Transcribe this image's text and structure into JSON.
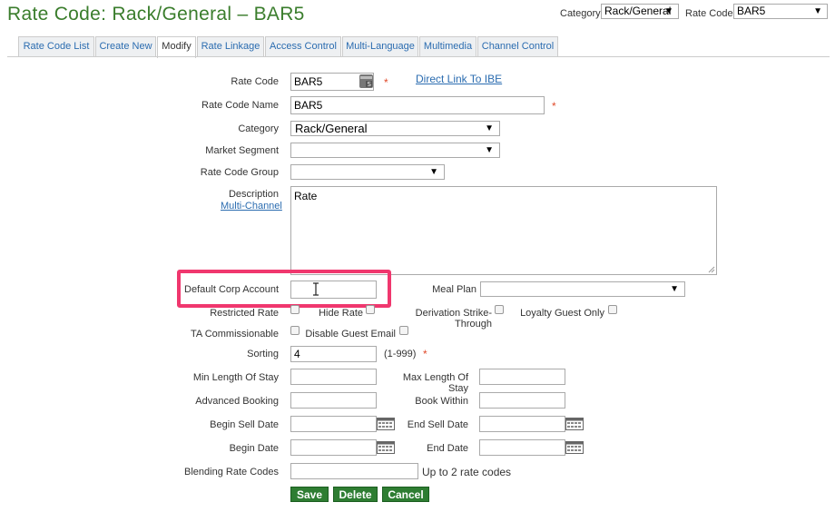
{
  "title": "Rate Code: Rack/General – BAR5",
  "top": {
    "category_label": "Category",
    "category_value": "Rack/General",
    "rate_code_label": "Rate Code",
    "rate_code_value": "BAR5"
  },
  "tabs": [
    {
      "label": "Rate Code List"
    },
    {
      "label": "Create New"
    },
    {
      "label": "Modify",
      "active": true
    },
    {
      "label": "Rate Linkage"
    },
    {
      "label": "Access Control"
    },
    {
      "label": "Multi-Language"
    },
    {
      "label": "Multimedia"
    },
    {
      "label": "Channel Control"
    }
  ],
  "form": {
    "rate_code_label": "Rate Code",
    "rate_code_value": "BAR5",
    "direct_link": "Direct Link To IBE",
    "rate_code_name_label": "Rate Code Name",
    "rate_code_name_value": "BAR5",
    "category_label": "Category",
    "category_value": "Rack/General",
    "market_segment_label": "Market Segment",
    "market_segment_value": "",
    "rate_code_group_label": "Rate Code Group",
    "rate_code_group_value": "",
    "description_label": "Description",
    "multi_channel_link": "Multi-Channel",
    "description_value": "Rate",
    "default_corp_label": "Default Corp Account",
    "default_corp_value": "",
    "meal_plan_label": "Meal Plan",
    "meal_plan_value": "",
    "restricted_rate_label": "Restricted Rate",
    "hide_rate_label": "Hide Rate",
    "derivation_label": "Derivation Strike-Through",
    "loyalty_label": "Loyalty Guest Only",
    "ta_label": "TA Commissionable",
    "disable_email_label": "Disable Guest Email",
    "sorting_label": "Sorting",
    "sorting_value": "4",
    "sorting_hint": "(1-999)",
    "min_los_label": "Min Length Of Stay",
    "max_los_label": "Max Length Of Stay",
    "adv_booking_label": "Advanced Booking",
    "book_within_label": "Book Within",
    "begin_sell_label": "Begin Sell Date",
    "end_sell_label": "End Sell Date",
    "begin_date_label": "Begin Date",
    "end_date_label": "End Date",
    "blending_label": "Blending Rate Codes",
    "blending_hint": "Up to 2 rate codes",
    "required_mark": "*"
  },
  "buttons": {
    "save": "Save",
    "delete": "Delete",
    "cancel": "Cancel"
  },
  "colors": {
    "title_green": "#3a7d2c",
    "button_green": "#2e7d32",
    "highlight_pink": "#f0376e",
    "link_blue": "#2b6cb0"
  }
}
